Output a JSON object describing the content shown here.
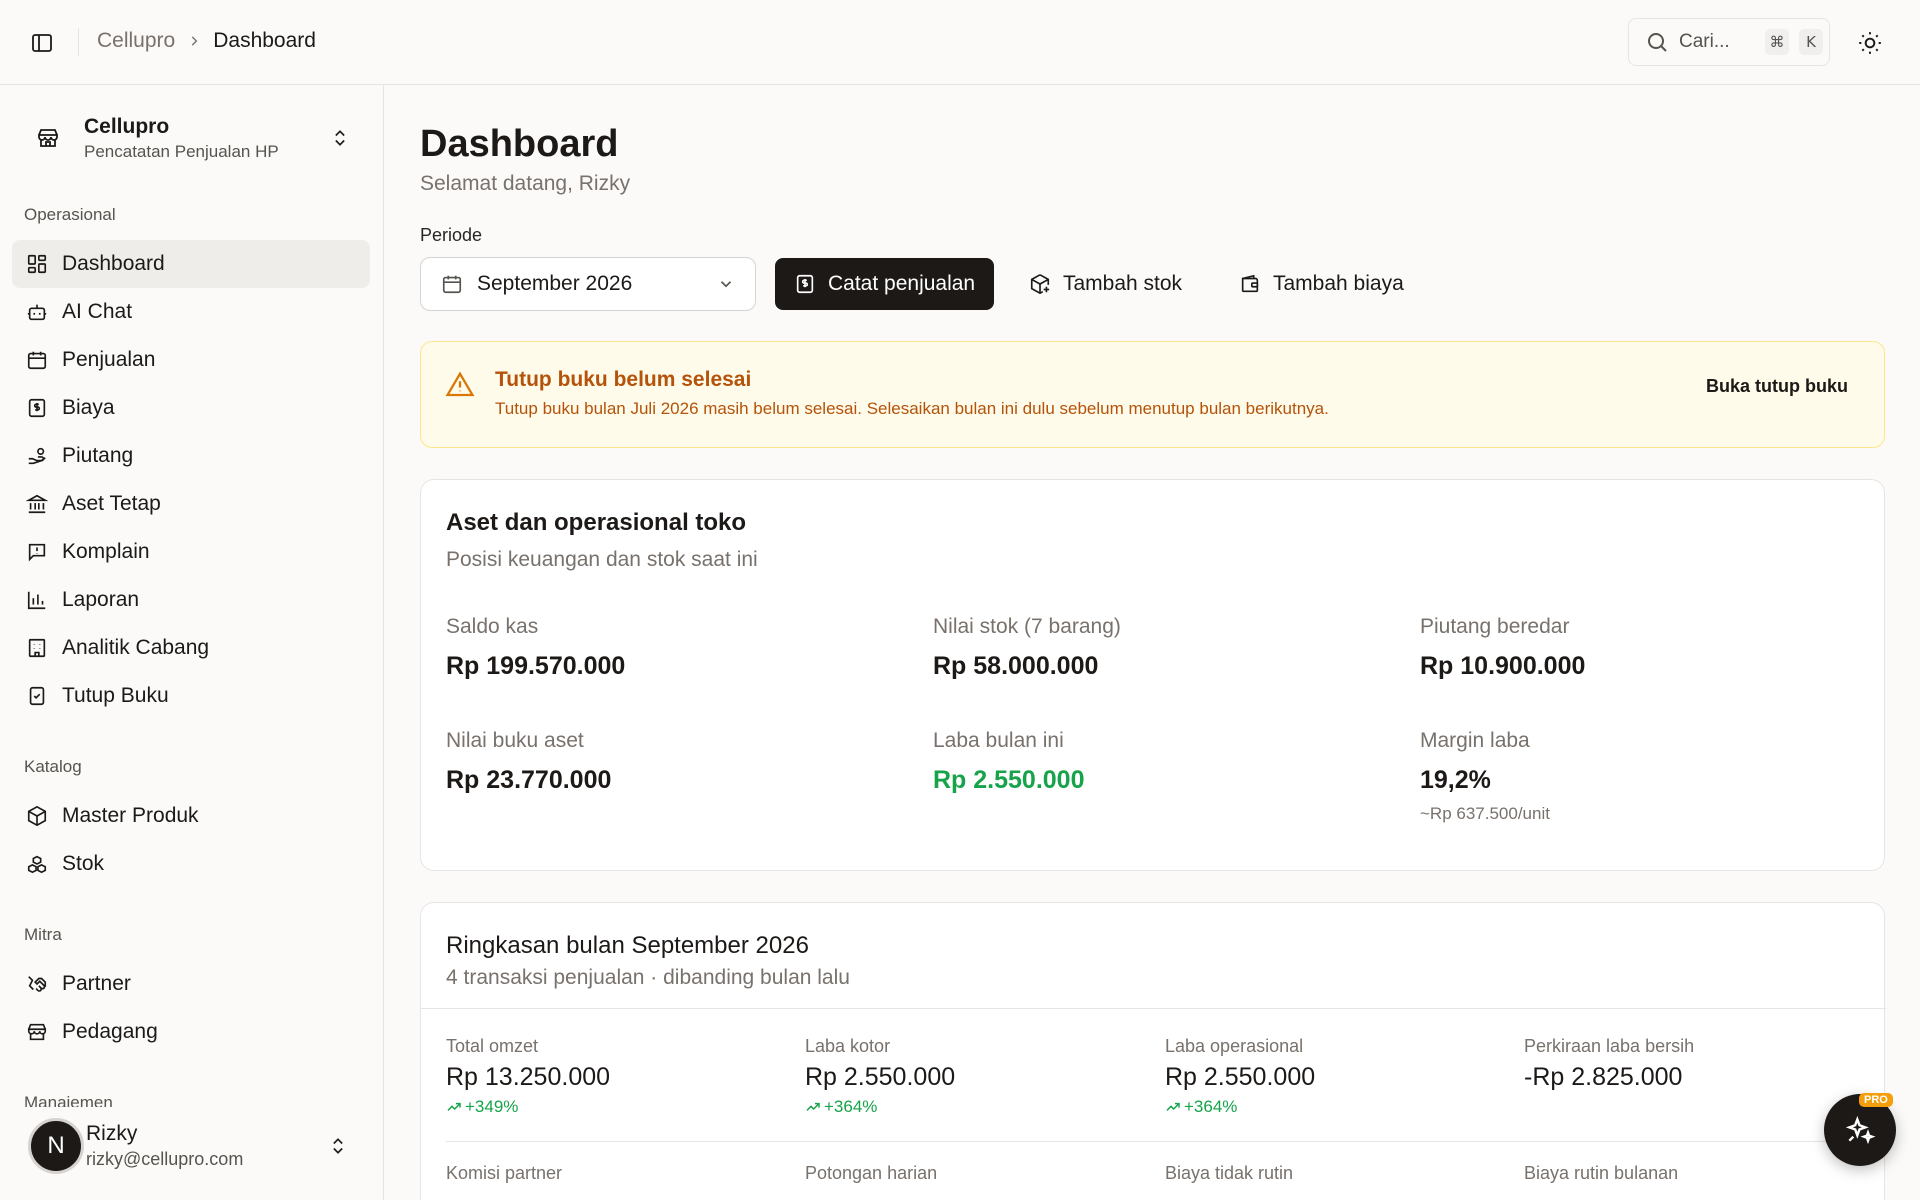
{
  "topbar": {
    "breadcrumb_root": "Cellupro",
    "breadcrumb_current": "Dashboard",
    "search_placeholder": "Cari...",
    "search_kbd_cmd": "⌘",
    "search_kbd_key": "K"
  },
  "sidebar": {
    "org_name": "Cellupro",
    "org_subtitle": "Pencatatan Penjualan HP",
    "sections": {
      "operasional": "Operasional",
      "katalog": "Katalog",
      "mitra": "Mitra",
      "manajemen": "Manajemen"
    },
    "items": {
      "dashboard": "Dashboard",
      "ai_chat": "AI Chat",
      "penjualan": "Penjualan",
      "biaya": "Biaya",
      "piutang": "Piutang",
      "aset_tetap": "Aset Tetap",
      "komplain": "Komplain",
      "laporan": "Laporan",
      "analitik_cabang": "Analitik Cabang",
      "tutup_buku": "Tutup Buku",
      "master_produk": "Master Produk",
      "stok": "Stok",
      "partner": "Partner",
      "pedagang": "Pedagang"
    },
    "user": {
      "initial": "N",
      "name": "Rizky",
      "email": "rizky@cellupro.com"
    }
  },
  "header": {
    "title": "Dashboard",
    "subtitle": "Selamat datang, Rizky",
    "periode_label": "Periode",
    "periode_value": "September 2026"
  },
  "actions": {
    "catat_penjualan": "Catat penjualan",
    "tambah_stok": "Tambah stok",
    "tambah_biaya": "Tambah biaya"
  },
  "alert": {
    "title": "Tutup buku belum selesai",
    "text": "Tutup buku bulan Juli 2026 masih belum selesai. Selesaikan bulan ini dulu sebelum menutup bulan berikutnya.",
    "button": "Buka tutup buku"
  },
  "assets_card": {
    "title": "Aset dan operasional toko",
    "subtitle": "Posisi keuangan dan stok saat ini",
    "stats": {
      "saldo_kas": {
        "label": "Saldo kas",
        "value": "Rp 199.570.000"
      },
      "nilai_stok": {
        "label": "Nilai stok (7 barang)",
        "value": "Rp 58.000.000"
      },
      "piutang": {
        "label": "Piutang beredar",
        "value": "Rp 10.900.000"
      },
      "nilai_buku": {
        "label": "Nilai buku aset",
        "value": "Rp 23.770.000"
      },
      "laba_bulan": {
        "label": "Laba bulan ini",
        "value": "Rp 2.550.000"
      },
      "margin": {
        "label": "Margin laba",
        "value": "19,2%",
        "note": "~Rp 637.500/unit"
      }
    }
  },
  "summary_card": {
    "title": "Ringkasan bulan September 2026",
    "subtitle": "4 transaksi penjualan · dibanding bulan lalu",
    "stats": {
      "omzet": {
        "label": "Total omzet",
        "value": "Rp 13.250.000",
        "delta": "+349%"
      },
      "laba_kotor": {
        "label": "Laba kotor",
        "value": "Rp 2.550.000",
        "delta": "+364%"
      },
      "laba_operasional": {
        "label": "Laba operasional",
        "value": "Rp 2.550.000",
        "delta": "+364%"
      },
      "laba_bersih": {
        "label": "Perkiraan laba bersih",
        "value": "-Rp 2.825.000"
      }
    },
    "more_labels": {
      "komisi": "Komisi partner",
      "potongan": "Potongan harian",
      "biaya_tidak_rutin": "Biaya tidak rutin",
      "biaya_rutin": "Biaya rutin bulanan"
    }
  },
  "fab": {
    "badge": "PRO",
    "icon": "sparkles-icon"
  },
  "colors": {
    "accent": "#1c1917",
    "positive": "#16a34a",
    "negative": "#dc2626",
    "warning": "#b45309"
  }
}
